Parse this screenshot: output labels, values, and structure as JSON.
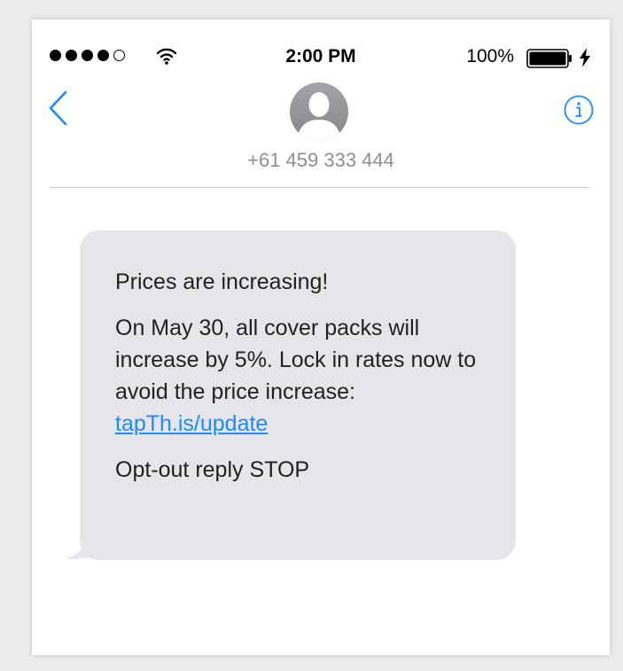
{
  "status_bar": {
    "time": "2:00 PM",
    "battery_percent": "100%",
    "signal_icons": [
      "signal-dot-filled",
      "signal-dot-filled",
      "signal-dot-filled",
      "signal-dot-filled",
      "signal-dot-empty"
    ]
  },
  "header": {
    "contact_number": "+61 459 333 444",
    "back_icon": "chevron-left-icon",
    "info_icon": "info-icon",
    "avatar_icon": "person-avatar-icon"
  },
  "message": {
    "line1": "Prices are increasing!",
    "body": "On May 30, all cover packs will increase by 5%. Lock in rates now to avoid the price increase:",
    "link": "tapTh.is/update",
    "optout": "Opt-out reply STOP"
  },
  "colors": {
    "accent": "#1a8cff",
    "bubble": "#e5e5ea"
  }
}
